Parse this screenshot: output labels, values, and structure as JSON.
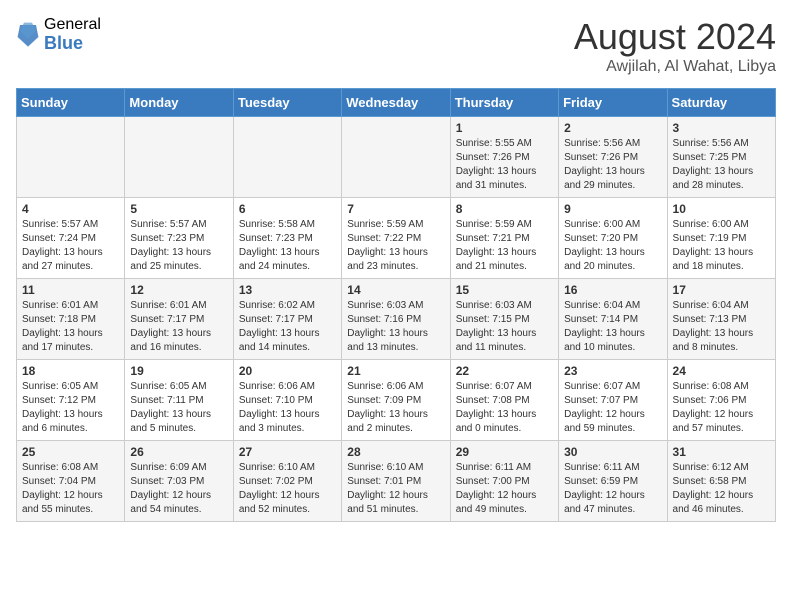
{
  "header": {
    "logo_general": "General",
    "logo_blue": "Blue",
    "month_title": "August 2024",
    "location": "Awjilah, Al Wahat, Libya"
  },
  "days_of_week": [
    "Sunday",
    "Monday",
    "Tuesday",
    "Wednesday",
    "Thursday",
    "Friday",
    "Saturday"
  ],
  "weeks": [
    [
      {
        "day": "",
        "info": ""
      },
      {
        "day": "",
        "info": ""
      },
      {
        "day": "",
        "info": ""
      },
      {
        "day": "",
        "info": ""
      },
      {
        "day": "1",
        "info": "Sunrise: 5:55 AM\nSunset: 7:26 PM\nDaylight: 13 hours\nand 31 minutes."
      },
      {
        "day": "2",
        "info": "Sunrise: 5:56 AM\nSunset: 7:26 PM\nDaylight: 13 hours\nand 29 minutes."
      },
      {
        "day": "3",
        "info": "Sunrise: 5:56 AM\nSunset: 7:25 PM\nDaylight: 13 hours\nand 28 minutes."
      }
    ],
    [
      {
        "day": "4",
        "info": "Sunrise: 5:57 AM\nSunset: 7:24 PM\nDaylight: 13 hours\nand 27 minutes."
      },
      {
        "day": "5",
        "info": "Sunrise: 5:57 AM\nSunset: 7:23 PM\nDaylight: 13 hours\nand 25 minutes."
      },
      {
        "day": "6",
        "info": "Sunrise: 5:58 AM\nSunset: 7:23 PM\nDaylight: 13 hours\nand 24 minutes."
      },
      {
        "day": "7",
        "info": "Sunrise: 5:59 AM\nSunset: 7:22 PM\nDaylight: 13 hours\nand 23 minutes."
      },
      {
        "day": "8",
        "info": "Sunrise: 5:59 AM\nSunset: 7:21 PM\nDaylight: 13 hours\nand 21 minutes."
      },
      {
        "day": "9",
        "info": "Sunrise: 6:00 AM\nSunset: 7:20 PM\nDaylight: 13 hours\nand 20 minutes."
      },
      {
        "day": "10",
        "info": "Sunrise: 6:00 AM\nSunset: 7:19 PM\nDaylight: 13 hours\nand 18 minutes."
      }
    ],
    [
      {
        "day": "11",
        "info": "Sunrise: 6:01 AM\nSunset: 7:18 PM\nDaylight: 13 hours\nand 17 minutes."
      },
      {
        "day": "12",
        "info": "Sunrise: 6:01 AM\nSunset: 7:17 PM\nDaylight: 13 hours\nand 16 minutes."
      },
      {
        "day": "13",
        "info": "Sunrise: 6:02 AM\nSunset: 7:17 PM\nDaylight: 13 hours\nand 14 minutes."
      },
      {
        "day": "14",
        "info": "Sunrise: 6:03 AM\nSunset: 7:16 PM\nDaylight: 13 hours\nand 13 minutes."
      },
      {
        "day": "15",
        "info": "Sunrise: 6:03 AM\nSunset: 7:15 PM\nDaylight: 13 hours\nand 11 minutes."
      },
      {
        "day": "16",
        "info": "Sunrise: 6:04 AM\nSunset: 7:14 PM\nDaylight: 13 hours\nand 10 minutes."
      },
      {
        "day": "17",
        "info": "Sunrise: 6:04 AM\nSunset: 7:13 PM\nDaylight: 13 hours\nand 8 minutes."
      }
    ],
    [
      {
        "day": "18",
        "info": "Sunrise: 6:05 AM\nSunset: 7:12 PM\nDaylight: 13 hours\nand 6 minutes."
      },
      {
        "day": "19",
        "info": "Sunrise: 6:05 AM\nSunset: 7:11 PM\nDaylight: 13 hours\nand 5 minutes."
      },
      {
        "day": "20",
        "info": "Sunrise: 6:06 AM\nSunset: 7:10 PM\nDaylight: 13 hours\nand 3 minutes."
      },
      {
        "day": "21",
        "info": "Sunrise: 6:06 AM\nSunset: 7:09 PM\nDaylight: 13 hours\nand 2 minutes."
      },
      {
        "day": "22",
        "info": "Sunrise: 6:07 AM\nSunset: 7:08 PM\nDaylight: 13 hours\nand 0 minutes."
      },
      {
        "day": "23",
        "info": "Sunrise: 6:07 AM\nSunset: 7:07 PM\nDaylight: 12 hours\nand 59 minutes."
      },
      {
        "day": "24",
        "info": "Sunrise: 6:08 AM\nSunset: 7:06 PM\nDaylight: 12 hours\nand 57 minutes."
      }
    ],
    [
      {
        "day": "25",
        "info": "Sunrise: 6:08 AM\nSunset: 7:04 PM\nDaylight: 12 hours\nand 55 minutes."
      },
      {
        "day": "26",
        "info": "Sunrise: 6:09 AM\nSunset: 7:03 PM\nDaylight: 12 hours\nand 54 minutes."
      },
      {
        "day": "27",
        "info": "Sunrise: 6:10 AM\nSunset: 7:02 PM\nDaylight: 12 hours\nand 52 minutes."
      },
      {
        "day": "28",
        "info": "Sunrise: 6:10 AM\nSunset: 7:01 PM\nDaylight: 12 hours\nand 51 minutes."
      },
      {
        "day": "29",
        "info": "Sunrise: 6:11 AM\nSunset: 7:00 PM\nDaylight: 12 hours\nand 49 minutes."
      },
      {
        "day": "30",
        "info": "Sunrise: 6:11 AM\nSunset: 6:59 PM\nDaylight: 12 hours\nand 47 minutes."
      },
      {
        "day": "31",
        "info": "Sunrise: 6:12 AM\nSunset: 6:58 PM\nDaylight: 12 hours\nand 46 minutes."
      }
    ]
  ]
}
